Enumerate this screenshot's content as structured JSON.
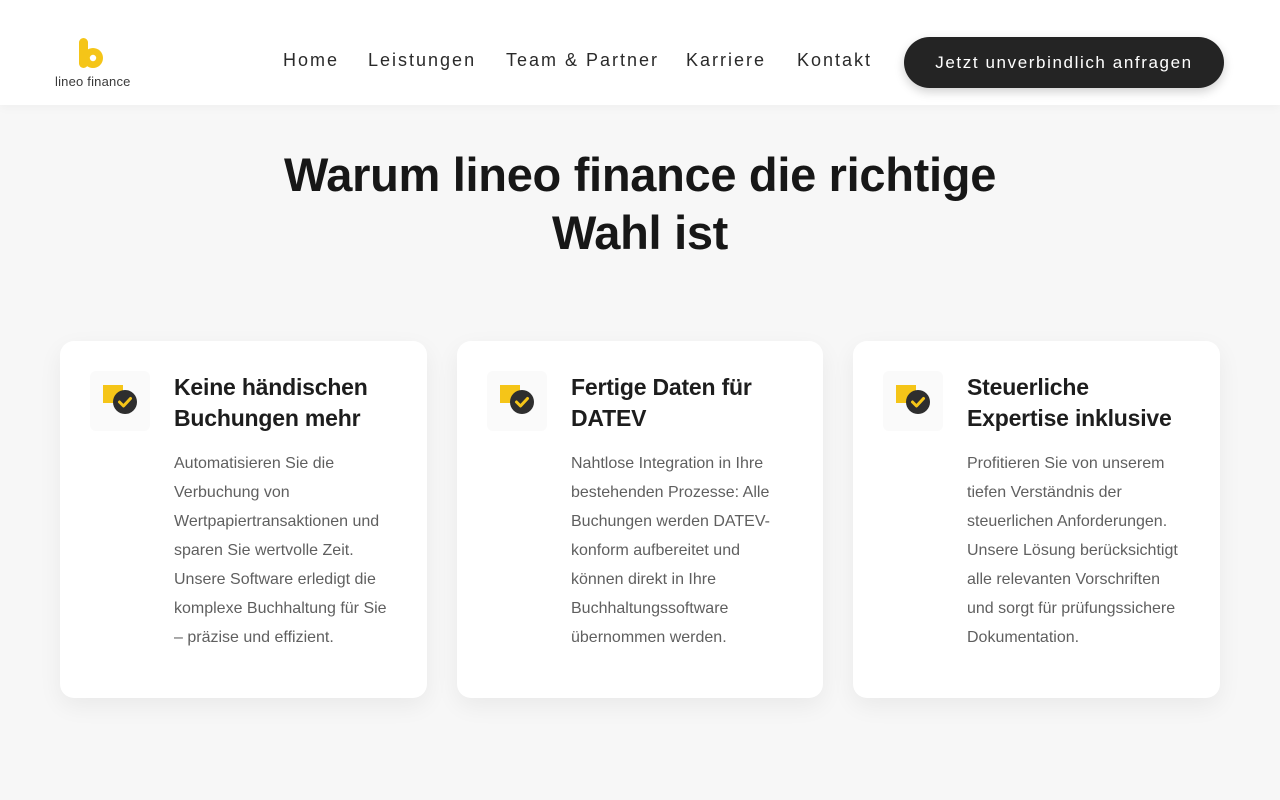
{
  "header": {
    "logo": {
      "text": "lineo finance",
      "icon": "lineo-logo-mark",
      "brand_color": "#F5C518"
    },
    "nav": [
      {
        "label": "Home"
      },
      {
        "label": "Leistungen"
      },
      {
        "label": "Team & Partner"
      },
      {
        "label": "Karriere"
      },
      {
        "label": "Kontakt"
      }
    ],
    "cta_label": "Jetzt unverbindlich anfragen"
  },
  "section": {
    "title_line1": "Warum lineo finance die richtige",
    "title_line2": "Wahl ist",
    "cards": [
      {
        "icon": "check-badge-icon",
        "title_line1": "Keine händischen",
        "title_line2": "Buchungen mehr",
        "text": "Automatisieren Sie die Verbuchung von Wertpapiertransaktionen und sparen Sie wertvolle Zeit. Unsere Software erledigt die komplexe Buchhaltung für Sie – präzise und effizient."
      },
      {
        "icon": "check-badge-icon",
        "title_line1": "Fertige Daten für",
        "title_line2": "DATEV",
        "text": "Nahtlose Integration in Ihre bestehenden Prozesse: Alle Buchungen werden DATEV-konform aufbereitet und können direkt in Ihre Buchhaltungssoftware übernommen werden."
      },
      {
        "icon": "check-badge-icon",
        "title_line1": "Steuerliche",
        "title_line2": "Expertise inklusive",
        "text": "Profitieren Sie von unserem tiefen Verständnis der steuerlichen Anforderungen. Unsere Lösung berücksichtigt alle relevanten Vorschriften und sorgt für prüfungssichere Dokumentation."
      }
    ]
  },
  "colors": {
    "accent": "#F5C518",
    "dark": "#242424",
    "background": "#F7F7F7"
  }
}
